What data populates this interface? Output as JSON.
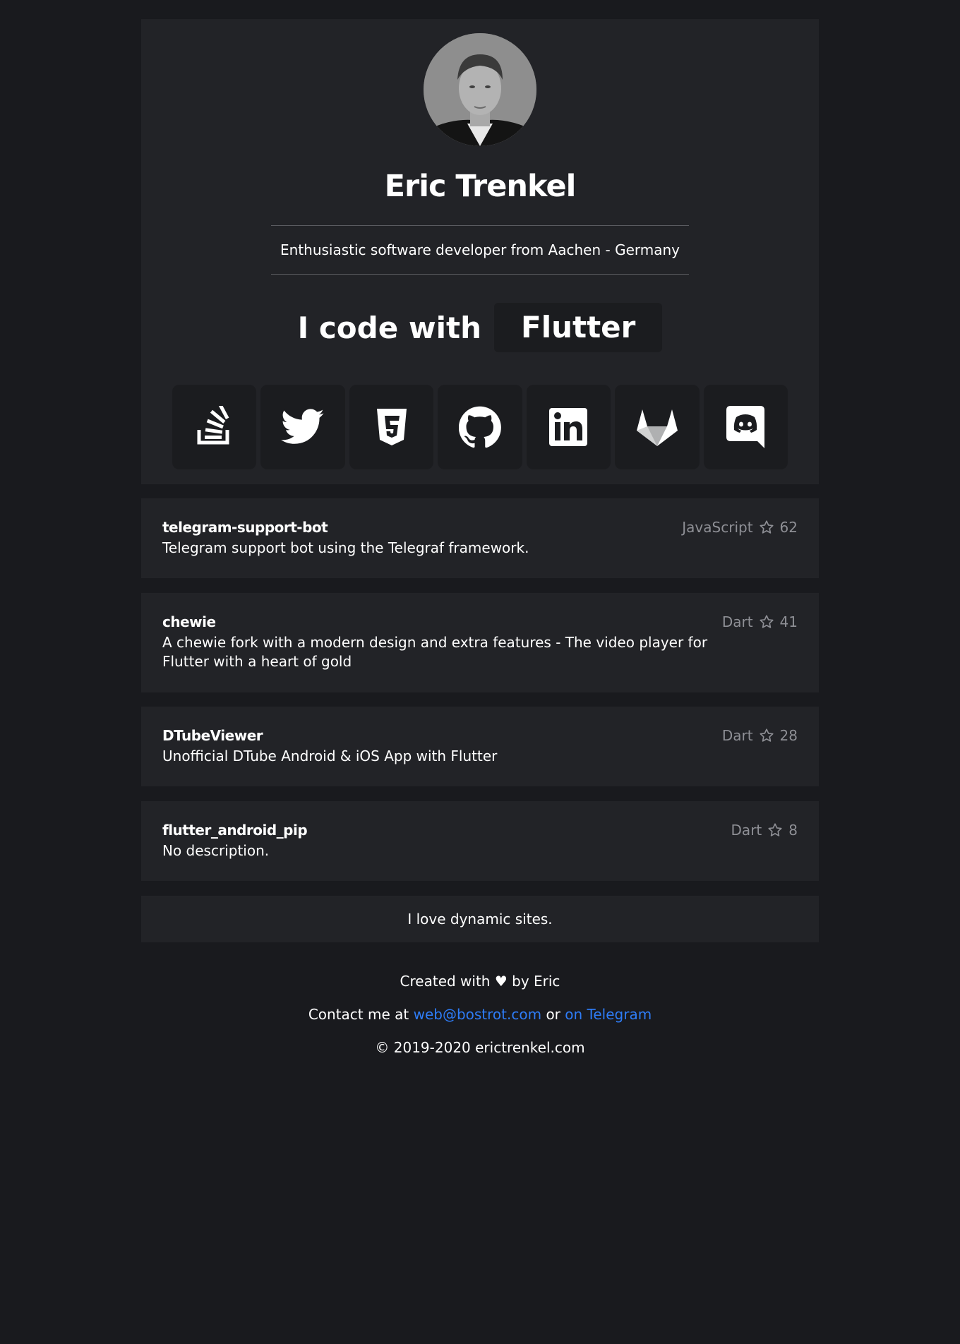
{
  "profile": {
    "name": "Eric Trenkel",
    "tagline": "Enthusiastic software developer from Aachen - Germany",
    "code_with_label": "I code with",
    "language": "Flutter"
  },
  "socials": [
    {
      "icon": "stackoverflow-icon"
    },
    {
      "icon": "twitter-icon"
    },
    {
      "icon": "html5-icon"
    },
    {
      "icon": "github-icon"
    },
    {
      "icon": "linkedin-icon"
    },
    {
      "icon": "gitlab-icon"
    },
    {
      "icon": "discord-icon"
    }
  ],
  "repos": [
    {
      "name": "telegram-support-bot",
      "description": "Telegram support bot using the Telegraf framework.",
      "language": "JavaScript",
      "stars": "62"
    },
    {
      "name": "chewie",
      "description": "A chewie fork with a modern design and extra features - The video player for Flutter with a heart of gold",
      "language": "Dart",
      "stars": "41"
    },
    {
      "name": "DTubeViewer",
      "description": "Unofficial DTube Android & iOS App with Flutter",
      "language": "Dart",
      "stars": "28"
    },
    {
      "name": "flutter_android_pip",
      "description": "No description.",
      "language": "Dart",
      "stars": "8"
    }
  ],
  "banner": "I love dynamic sites.",
  "footer": {
    "created": "Created with ♥ by Eric",
    "contact_prefix": "Contact me at",
    "email": "web@bostrot.com",
    "or": "or",
    "telegram": "on Telegram",
    "copyright": "© 2019-2020 erictrenkel.com"
  },
  "colors": {
    "background": "#191a1e",
    "panel": "#222327",
    "button": "#1b1c1f",
    "link": "#2e7cf6",
    "muted": "#8e8f95"
  }
}
